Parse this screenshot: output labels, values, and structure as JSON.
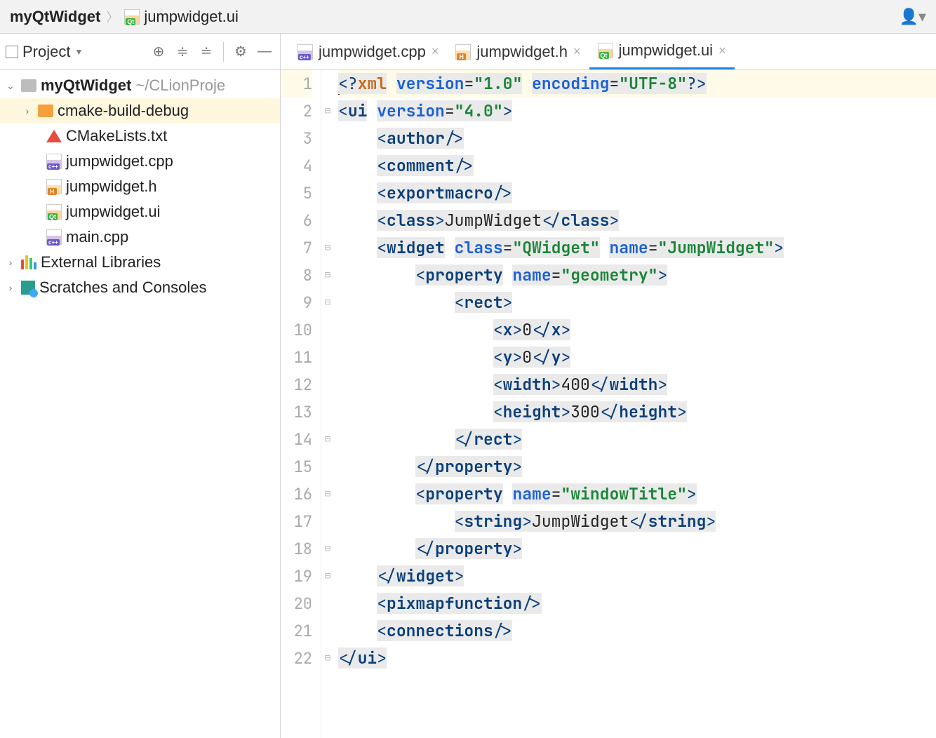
{
  "breadcrumb": {
    "items": [
      {
        "label": "myQtWidget",
        "bold": true
      },
      {
        "label": "jumpwidget.ui",
        "icon": "ui"
      }
    ]
  },
  "sidebar": {
    "project_label": "Project",
    "tree": {
      "root": {
        "label": "myQtWidget",
        "path": "~/CLionProje"
      },
      "folder_debug": "cmake-build-debug",
      "cmakelists": "CMakeLists.txt",
      "cpp": "jumpwidget.cpp",
      "h": "jumpwidget.h",
      "ui": "jumpwidget.ui",
      "main": "main.cpp",
      "ext": "External Libraries",
      "scratch": "Scratches and Consoles"
    }
  },
  "tabs": [
    {
      "label": "jumpwidget.cpp",
      "icon": "cpp",
      "active": false
    },
    {
      "label": "jumpwidget.h",
      "icon": "h",
      "active": false
    },
    {
      "label": "jumpwidget.ui",
      "icon": "ui",
      "active": true
    }
  ],
  "editor": {
    "line_numbers": [
      "1",
      "2",
      "3",
      "4",
      "5",
      "6",
      "7",
      "8",
      "9",
      "10",
      "11",
      "12",
      "13",
      "14",
      "15",
      "16",
      "17",
      "18",
      "19",
      "20",
      "21",
      "22"
    ],
    "fold_markers": [
      "",
      "⊟",
      "",
      "",
      "",
      "",
      "⊟",
      "⊟",
      "⊟",
      "",
      "",
      "",
      "",
      "⊟",
      "",
      "⊟",
      "",
      "⊟",
      "⊟",
      "",
      "",
      "⊟"
    ],
    "xml": {
      "decl_target": "xml",
      "decl_attr_version": "version",
      "decl_val_version": "\"1.0\"",
      "decl_attr_encoding": "encoding",
      "decl_val_encoding": "\"UTF-8\"",
      "ui_tag": "ui",
      "ui_attr_version": "version",
      "ui_val_version": "\"4.0\"",
      "author_tag": "author",
      "comment_tag": "comment",
      "exportmacro_tag": "exportmacro",
      "class_tag": "class",
      "class_text": "JumpWidget",
      "widget_tag": "widget",
      "widget_attr_class": "class",
      "widget_val_class": "\"QWidget\"",
      "widget_attr_name": "name",
      "widget_val_name": "\"JumpWidget\"",
      "property_tag": "property",
      "property_attr_name": "name",
      "property_val_geometry": "\"geometry\"",
      "rect_tag": "rect",
      "x_tag": "x",
      "x_text": "0",
      "y_tag": "y",
      "y_text": "0",
      "width_tag": "width",
      "width_text": "400",
      "height_tag": "height",
      "height_text": "300",
      "property_val_windowTitle": "\"windowTitle\"",
      "string_tag": "string",
      "string_text": "JumpWidget",
      "pixmapfunction_tag": "pixmapfunction",
      "connections_tag": "connections"
    }
  }
}
